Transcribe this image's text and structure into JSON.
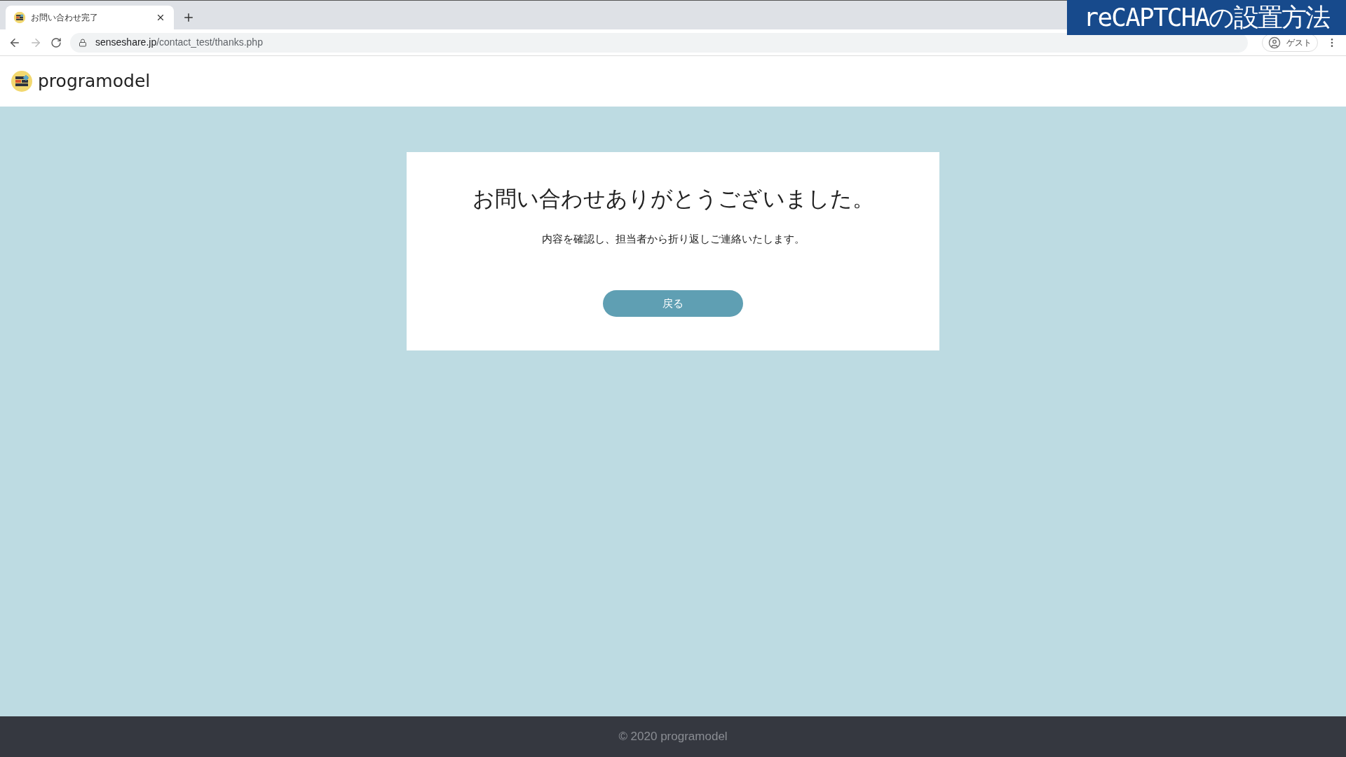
{
  "browser": {
    "tabs": [
      {
        "title": "お問い合わせ完了",
        "selected": true
      }
    ],
    "url_host": "senseshare.jp",
    "url_path": "/contact_test/thanks.php",
    "profile": "ゲスト"
  },
  "overlay_banner": "reCAPTCHAの設置方法",
  "site": {
    "logo_text": "programodel"
  },
  "card": {
    "heading": "お問い合わせありがとうございました。",
    "message": "内容を確認し、担当者から折り返しご連絡いたします。",
    "button": "戻る"
  },
  "footer": "© 2020 programodel"
}
